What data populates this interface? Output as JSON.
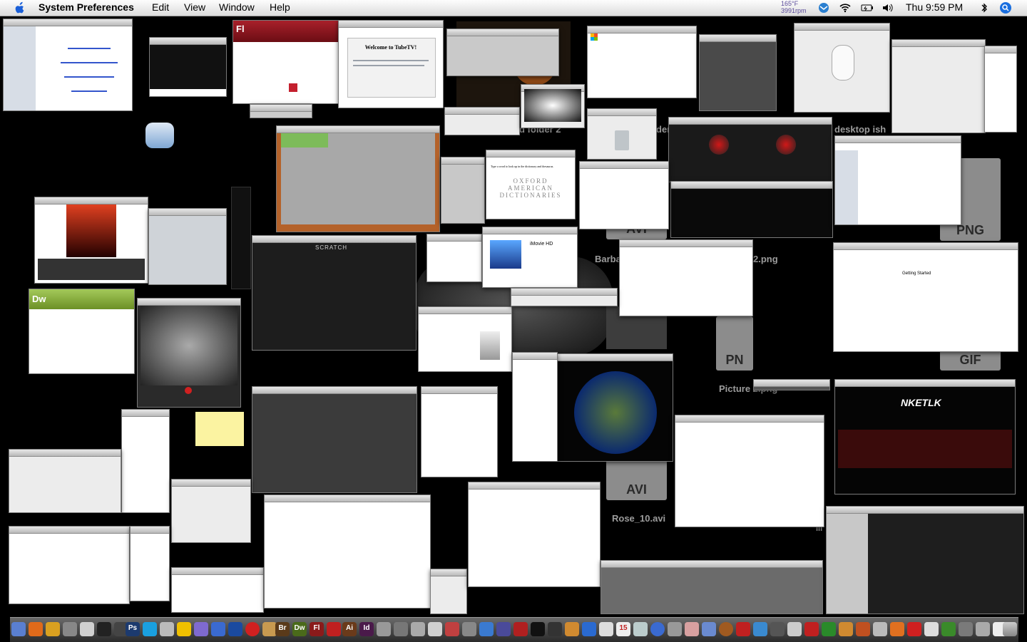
{
  "menubar": {
    "app_name": "System Preferences",
    "menus": [
      "Edit",
      "View",
      "Window",
      "Help"
    ],
    "temperature": "165°F",
    "fan_speed": "3991rpm",
    "clock": "Thu 9:59 PM"
  },
  "desktop": {
    "labels": {
      "folder2": "d folder 2",
      "desktop_ish": "desktop ish",
      "barba": "Barba",
      "png2": "2.png",
      "picture2": "Picture 2.png",
      "rose": "Rose_10.avi",
      "den": "den",
      "iii": "iii"
    },
    "file_types": {
      "avi1": "AVI",
      "avi2": "AVI",
      "png": "PNG",
      "pn": "PN",
      "gif": "GIF"
    }
  },
  "windows": {
    "flash_logo": "Fl",
    "dreamweaver_logo": "Dw",
    "tubetv_heading": "Welcome to TubeTV!",
    "oxford_dict": "OXFORD AMERICAN DICTIONARIES",
    "oxford_prompt": "Type a word to look up in the dictionary and thesaurus.",
    "imovie_title": "iMovie HD",
    "getting_started": "Getting Started",
    "nketlk_logo": "NKETLK",
    "scratch_logo": "SCRATCH"
  },
  "dock": {
    "labels": [
      "Ps",
      "Br",
      "Dw",
      "Fl",
      "Ai",
      "Id",
      "15"
    ]
  },
  "colors": {
    "desktop_bg": "#000000",
    "menubar_bg": "#f0f0f0",
    "accent_red": "#c4202e",
    "dw_green": "#7fa52f",
    "sticky_yellow": "#fbf3a1"
  }
}
